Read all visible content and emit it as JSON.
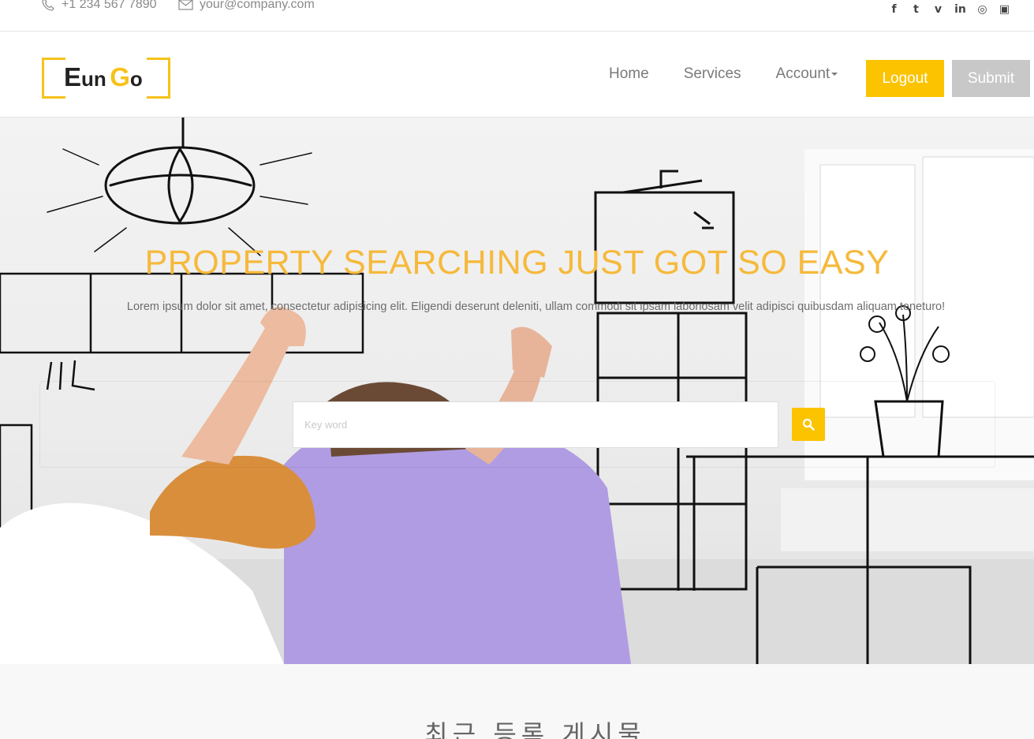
{
  "topbar": {
    "phone": "+1 234 567 7890",
    "email": "your@company.com",
    "social": [
      {
        "icon": "facebook-icon",
        "glyph": "f"
      },
      {
        "icon": "twitter-icon",
        "glyph": "t"
      },
      {
        "icon": "vine-icon",
        "glyph": "v"
      },
      {
        "icon": "linkedin-icon",
        "glyph": "in"
      },
      {
        "icon": "dribbble-icon",
        "glyph": "◎"
      },
      {
        "icon": "instagram-icon",
        "glyph": "▣"
      }
    ]
  },
  "header": {
    "logo": {
      "letter1": "E",
      "part1": "un",
      "letter2": "G",
      "part2": "o"
    },
    "nav": {
      "home": "Home",
      "services": "Services",
      "account": "Account"
    },
    "logout_label": "Logout",
    "submit_label": "Submit"
  },
  "hero": {
    "title": "PROPERTY SEARCHING JUST GOT SO EASY",
    "subtitle": "Lorem ipsum dolor sit amet, consectetur adipisicing elit. Eligendi deserunt deleniti, ullam commodi sit ipsam laboriosam velit adipisci quibusdam aliquam teneturo!",
    "search_placeholder": "Key word"
  },
  "recent": {
    "title": "최근 등록 게시물"
  },
  "colors": {
    "accent": "#fbc300",
    "title": "#f6b93b",
    "submit_bg": "#c8c8c8"
  }
}
